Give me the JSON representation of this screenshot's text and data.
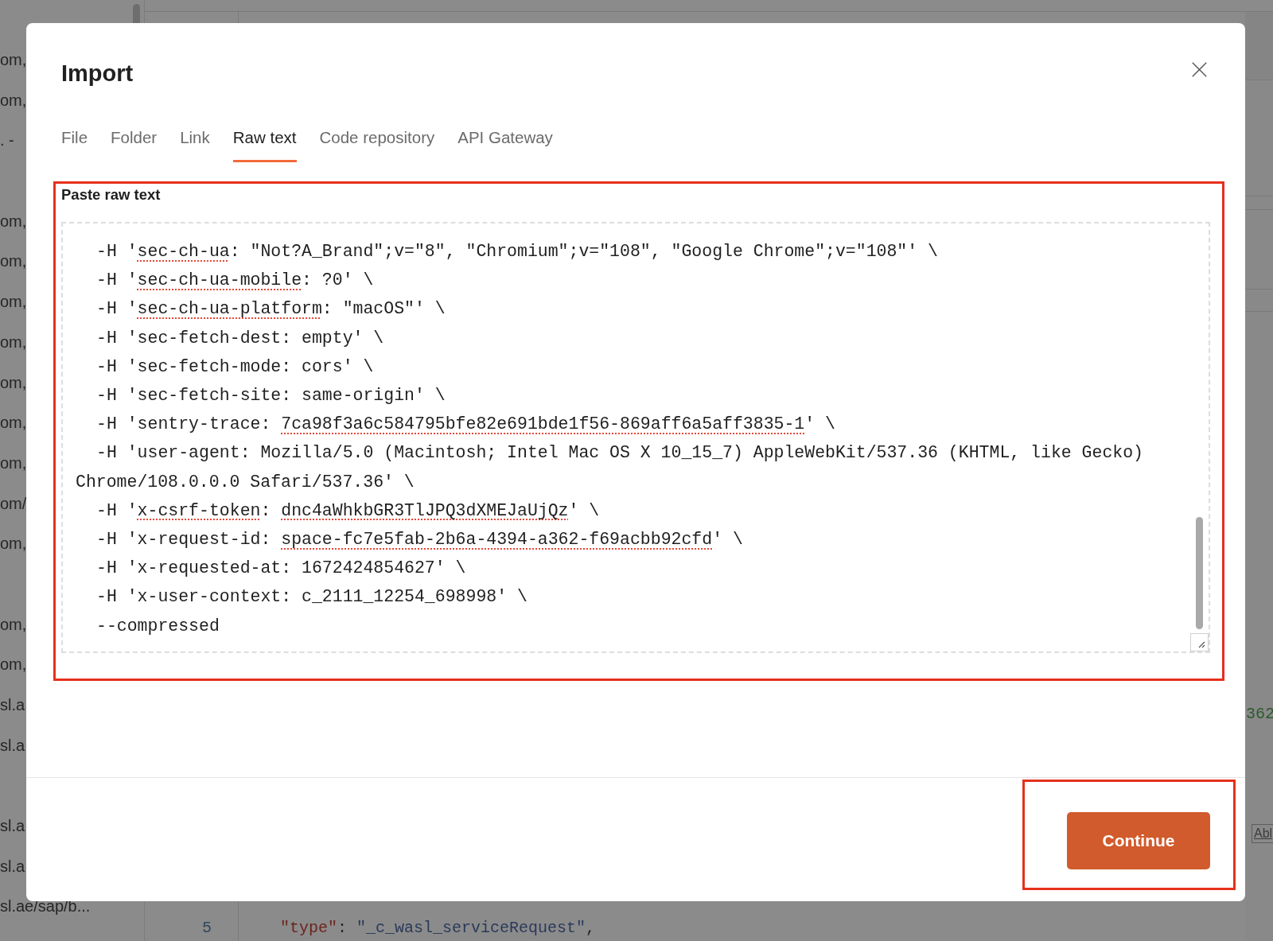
{
  "background": {
    "sidebar_groups": [
      [
        "om,",
        "om,",
        ". -"
      ],
      [
        "om,",
        "om,",
        "om,",
        "om,",
        "om,",
        "om,",
        "om,",
        "om/",
        "om,"
      ],
      [
        "om,",
        "om,",
        "sl.a",
        "sl.a"
      ],
      [
        "sl.a",
        "sl.a",
        "sl.ae/sap/b..."
      ]
    ],
    "panel_fragments": [
      {
        "kind": "value",
        "text": "362"
      },
      {
        "kind": "button",
        "text": "Abl"
      }
    ],
    "editor_lines": [
      {
        "number": "5",
        "tokens": [
          {
            "kind": "key",
            "text": "\"type\""
          },
          {
            "kind": "punct",
            "text": ": "
          },
          {
            "kind": "string",
            "text": "\"_c_wasl_serviceRequest\""
          },
          {
            "kind": "punct",
            "text": ","
          }
        ]
      }
    ]
  },
  "dialog": {
    "title": "Import",
    "tabs": [
      {
        "label": "File",
        "selected": false
      },
      {
        "label": "Folder",
        "selected": false
      },
      {
        "label": "Link",
        "selected": false
      },
      {
        "label": "Raw text",
        "selected": true
      },
      {
        "label": "Code repository",
        "selected": false
      },
      {
        "label": "API Gateway",
        "selected": false
      }
    ],
    "raw_text": {
      "label": "Paste raw text",
      "lines": [
        {
          "segments": [
            {
              "text": "-H '",
              "flagged": false
            },
            {
              "text": "sec-ch-ua",
              "flagged": true
            },
            {
              "text": ": \"Not?A_Brand\";v=\"8\", \"Chromium\";v=\"108\", \"Google Chrome\";v=\"108\"' \\",
              "flagged": false
            }
          ]
        },
        {
          "segments": [
            {
              "text": "-H '",
              "flagged": false
            },
            {
              "text": "sec-ch-ua-mobile",
              "flagged": true
            },
            {
              "text": ": ?0' \\",
              "flagged": false
            }
          ]
        },
        {
          "segments": [
            {
              "text": "-H '",
              "flagged": false
            },
            {
              "text": "sec-ch-ua-platform",
              "flagged": true
            },
            {
              "text": ": \"macOS\"' \\",
              "flagged": false
            }
          ]
        },
        {
          "segments": [
            {
              "text": "-H 'sec-fetch-dest: empty' \\",
              "flagged": false
            }
          ]
        },
        {
          "segments": [
            {
              "text": "-H 'sec-fetch-mode: cors' \\",
              "flagged": false
            }
          ]
        },
        {
          "segments": [
            {
              "text": "-H 'sec-fetch-site: same-origin' \\",
              "flagged": false
            }
          ]
        },
        {
          "segments": [
            {
              "text": "-H 'sentry-trace: ",
              "flagged": false
            },
            {
              "text": "7ca98f3a6c584795bfe82e691bde1f56-869aff6a5aff3835-1",
              "flagged": true
            },
            {
              "text": "' \\",
              "flagged": false
            }
          ]
        },
        {
          "segments": [
            {
              "text": "-H 'user-agent: Mozilla/5.0 (Macintosh; Intel Mac OS X 10_15_7) AppleWebKit/537.36 (KHTML, like Gecko) Chrome/108.0.0.0 Safari/537.36' \\",
              "flagged": false
            }
          ]
        },
        {
          "segments": [
            {
              "text": "-H '",
              "flagged": false
            },
            {
              "text": "x-csrf-token",
              "flagged": true
            },
            {
              "text": ": ",
              "flagged": false
            },
            {
              "text": "dnc4aWhkbGR3TlJPQ3dXMEJaUjQz",
              "flagged": true
            },
            {
              "text": "' \\",
              "flagged": false
            }
          ]
        },
        {
          "segments": [
            {
              "text": "-H 'x-request-id: ",
              "flagged": false
            },
            {
              "text": "space-fc7e5fab-2b6a-4394-a362-f69acbb92cfd",
              "flagged": true
            },
            {
              "text": "' \\",
              "flagged": false
            }
          ]
        },
        {
          "segments": [
            {
              "text": "-H 'x-requested-at: 1672424854627' \\",
              "flagged": false
            }
          ]
        },
        {
          "segments": [
            {
              "text": "-H 'x-user-context: c_2111_12254_698998' \\",
              "flagged": false
            }
          ]
        },
        {
          "segments": [
            {
              "text": "--compressed",
              "flagged": false
            }
          ]
        }
      ]
    },
    "continue_button": "Continue"
  }
}
